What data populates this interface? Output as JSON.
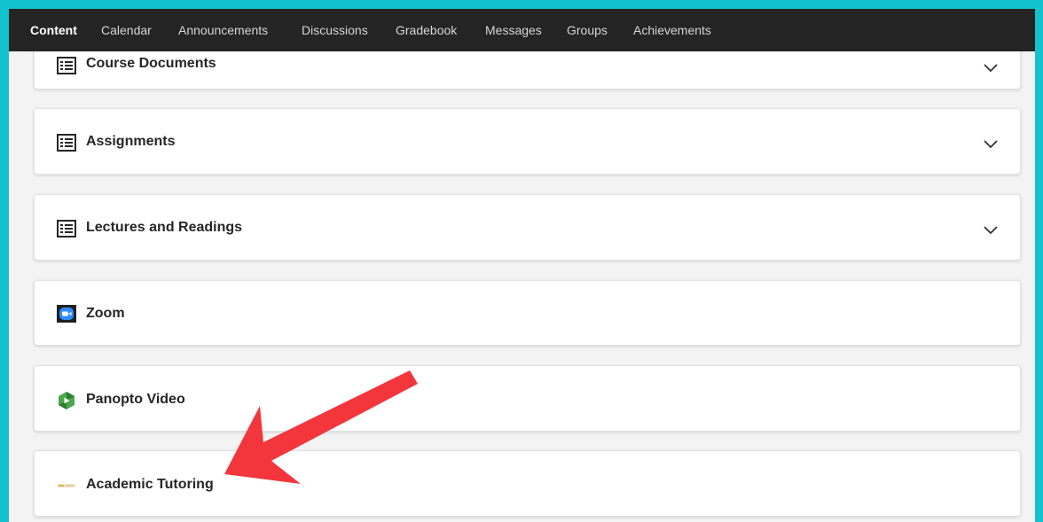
{
  "nav": {
    "tabs": [
      {
        "label": "Content",
        "active": true
      },
      {
        "label": "Calendar"
      },
      {
        "label": "Announcements"
      },
      {
        "label": "Discussions"
      },
      {
        "label": "Gradebook"
      },
      {
        "label": "Messages"
      },
      {
        "label": "Groups"
      },
      {
        "label": "Achievements"
      }
    ]
  },
  "items": [
    {
      "label": "Course Documents",
      "icon": "document-list-icon",
      "expandable": true
    },
    {
      "label": "Assignments",
      "icon": "document-list-icon",
      "expandable": true
    },
    {
      "label": "Lectures and Readings",
      "icon": "document-list-icon",
      "expandable": true
    },
    {
      "label": "Zoom",
      "icon": "zoom-logo-icon",
      "expandable": false
    },
    {
      "label": "Panopto Video",
      "icon": "panopto-logo-icon",
      "expandable": false
    },
    {
      "label": "Academic Tutoring",
      "icon": "tutoring-logo-icon",
      "expandable": false
    }
  ],
  "colors": {
    "border_frame": "#12c3cd",
    "topbar": "#242424",
    "arrow": "#f2363b",
    "zoom_blue": "#2d8cff",
    "panopto_green": "#4aa84b"
  }
}
